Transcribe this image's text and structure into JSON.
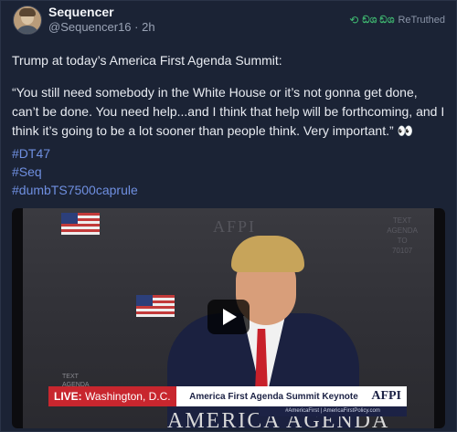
{
  "post": {
    "author_name": "Sequencer",
    "handle": "@Sequencer16",
    "separator": " · ",
    "time": "2h",
    "retruth_tag": "ඞශ ඞශ",
    "retruth_label": "ReTruthed",
    "intro": "Trump at today’s America First Agenda Summit:",
    "quote": "“You still need somebody in the White House or it’s not gonna get done, can’t be done. You need help...and I think that help will be forthcoming, and I think it’s going to be a lot sooner than people think. Very important.” 👀",
    "hashtags": [
      "#DT47",
      "#Seq",
      "#dumbTS7500caprule"
    ]
  },
  "video": {
    "bg_logo": "AFPI",
    "bg_text_right": "TEXT\nAGENDA\nTO\n70107",
    "small_text_left": "TEXT\nAGENDA",
    "live_label": "LIVE:",
    "location": "Washington, D.C.",
    "headline": "America First Agenda Summit Keynote",
    "logo": "AFPI",
    "sub_strip": "#AmericaFirst | AmericaFirstPolicy.com",
    "bottom_text": "AMERICA AGENDA"
  },
  "colors": {
    "background": "#1b2335",
    "hashtag": "#6f8fe0",
    "retruth_accent": "#3fb871",
    "live_red": "#c8262e"
  }
}
